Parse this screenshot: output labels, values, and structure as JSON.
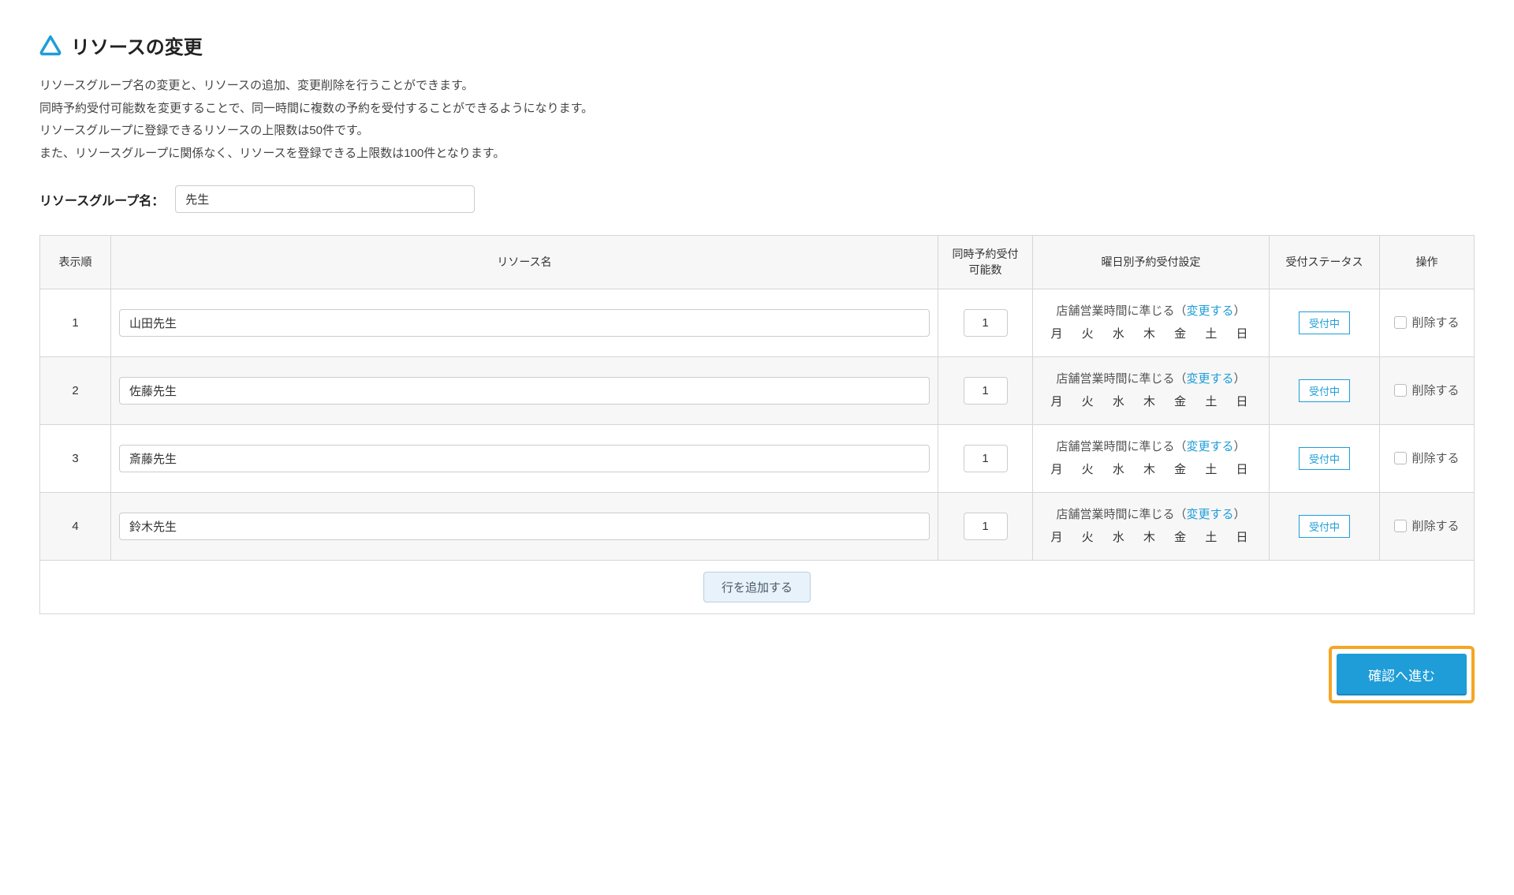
{
  "page": {
    "title": "リソースの変更",
    "description_lines": [
      "リソースグループ名の変更と、リソースの追加、変更削除を行うことができます。",
      "同時予約受付可能数を変更することで、同一時間に複数の予約を受付することができるようになります。",
      "リソースグループに登録できるリソースの上限数は50件です。",
      "また、リソースグループに関係なく、リソースを登録できる上限数は100件となります。"
    ]
  },
  "group": {
    "label": "リソースグループ名：",
    "value": "先生"
  },
  "table": {
    "headers": {
      "order": "表示順",
      "name": "リソース名",
      "capacity": "同時予約受付\n可能数",
      "weekday": "曜日別予約受付設定",
      "status": "受付ステータス",
      "action": "操作"
    },
    "weekday_text": {
      "prefix": "店舗営業時間に準じる（",
      "link": "変更する",
      "suffix": "）",
      "days": "月 火 水 木 金 土 日"
    },
    "status_label": "受付中",
    "delete_label": "削除する",
    "add_row_label": "行を追加する",
    "rows": [
      {
        "order": "1",
        "name": "山田先生",
        "capacity": "1"
      },
      {
        "order": "2",
        "name": "佐藤先生",
        "capacity": "1"
      },
      {
        "order": "3",
        "name": "斎藤先生",
        "capacity": "1"
      },
      {
        "order": "4",
        "name": "鈴木先生",
        "capacity": "1"
      }
    ]
  },
  "footer": {
    "confirm_label": "確認へ進む"
  }
}
